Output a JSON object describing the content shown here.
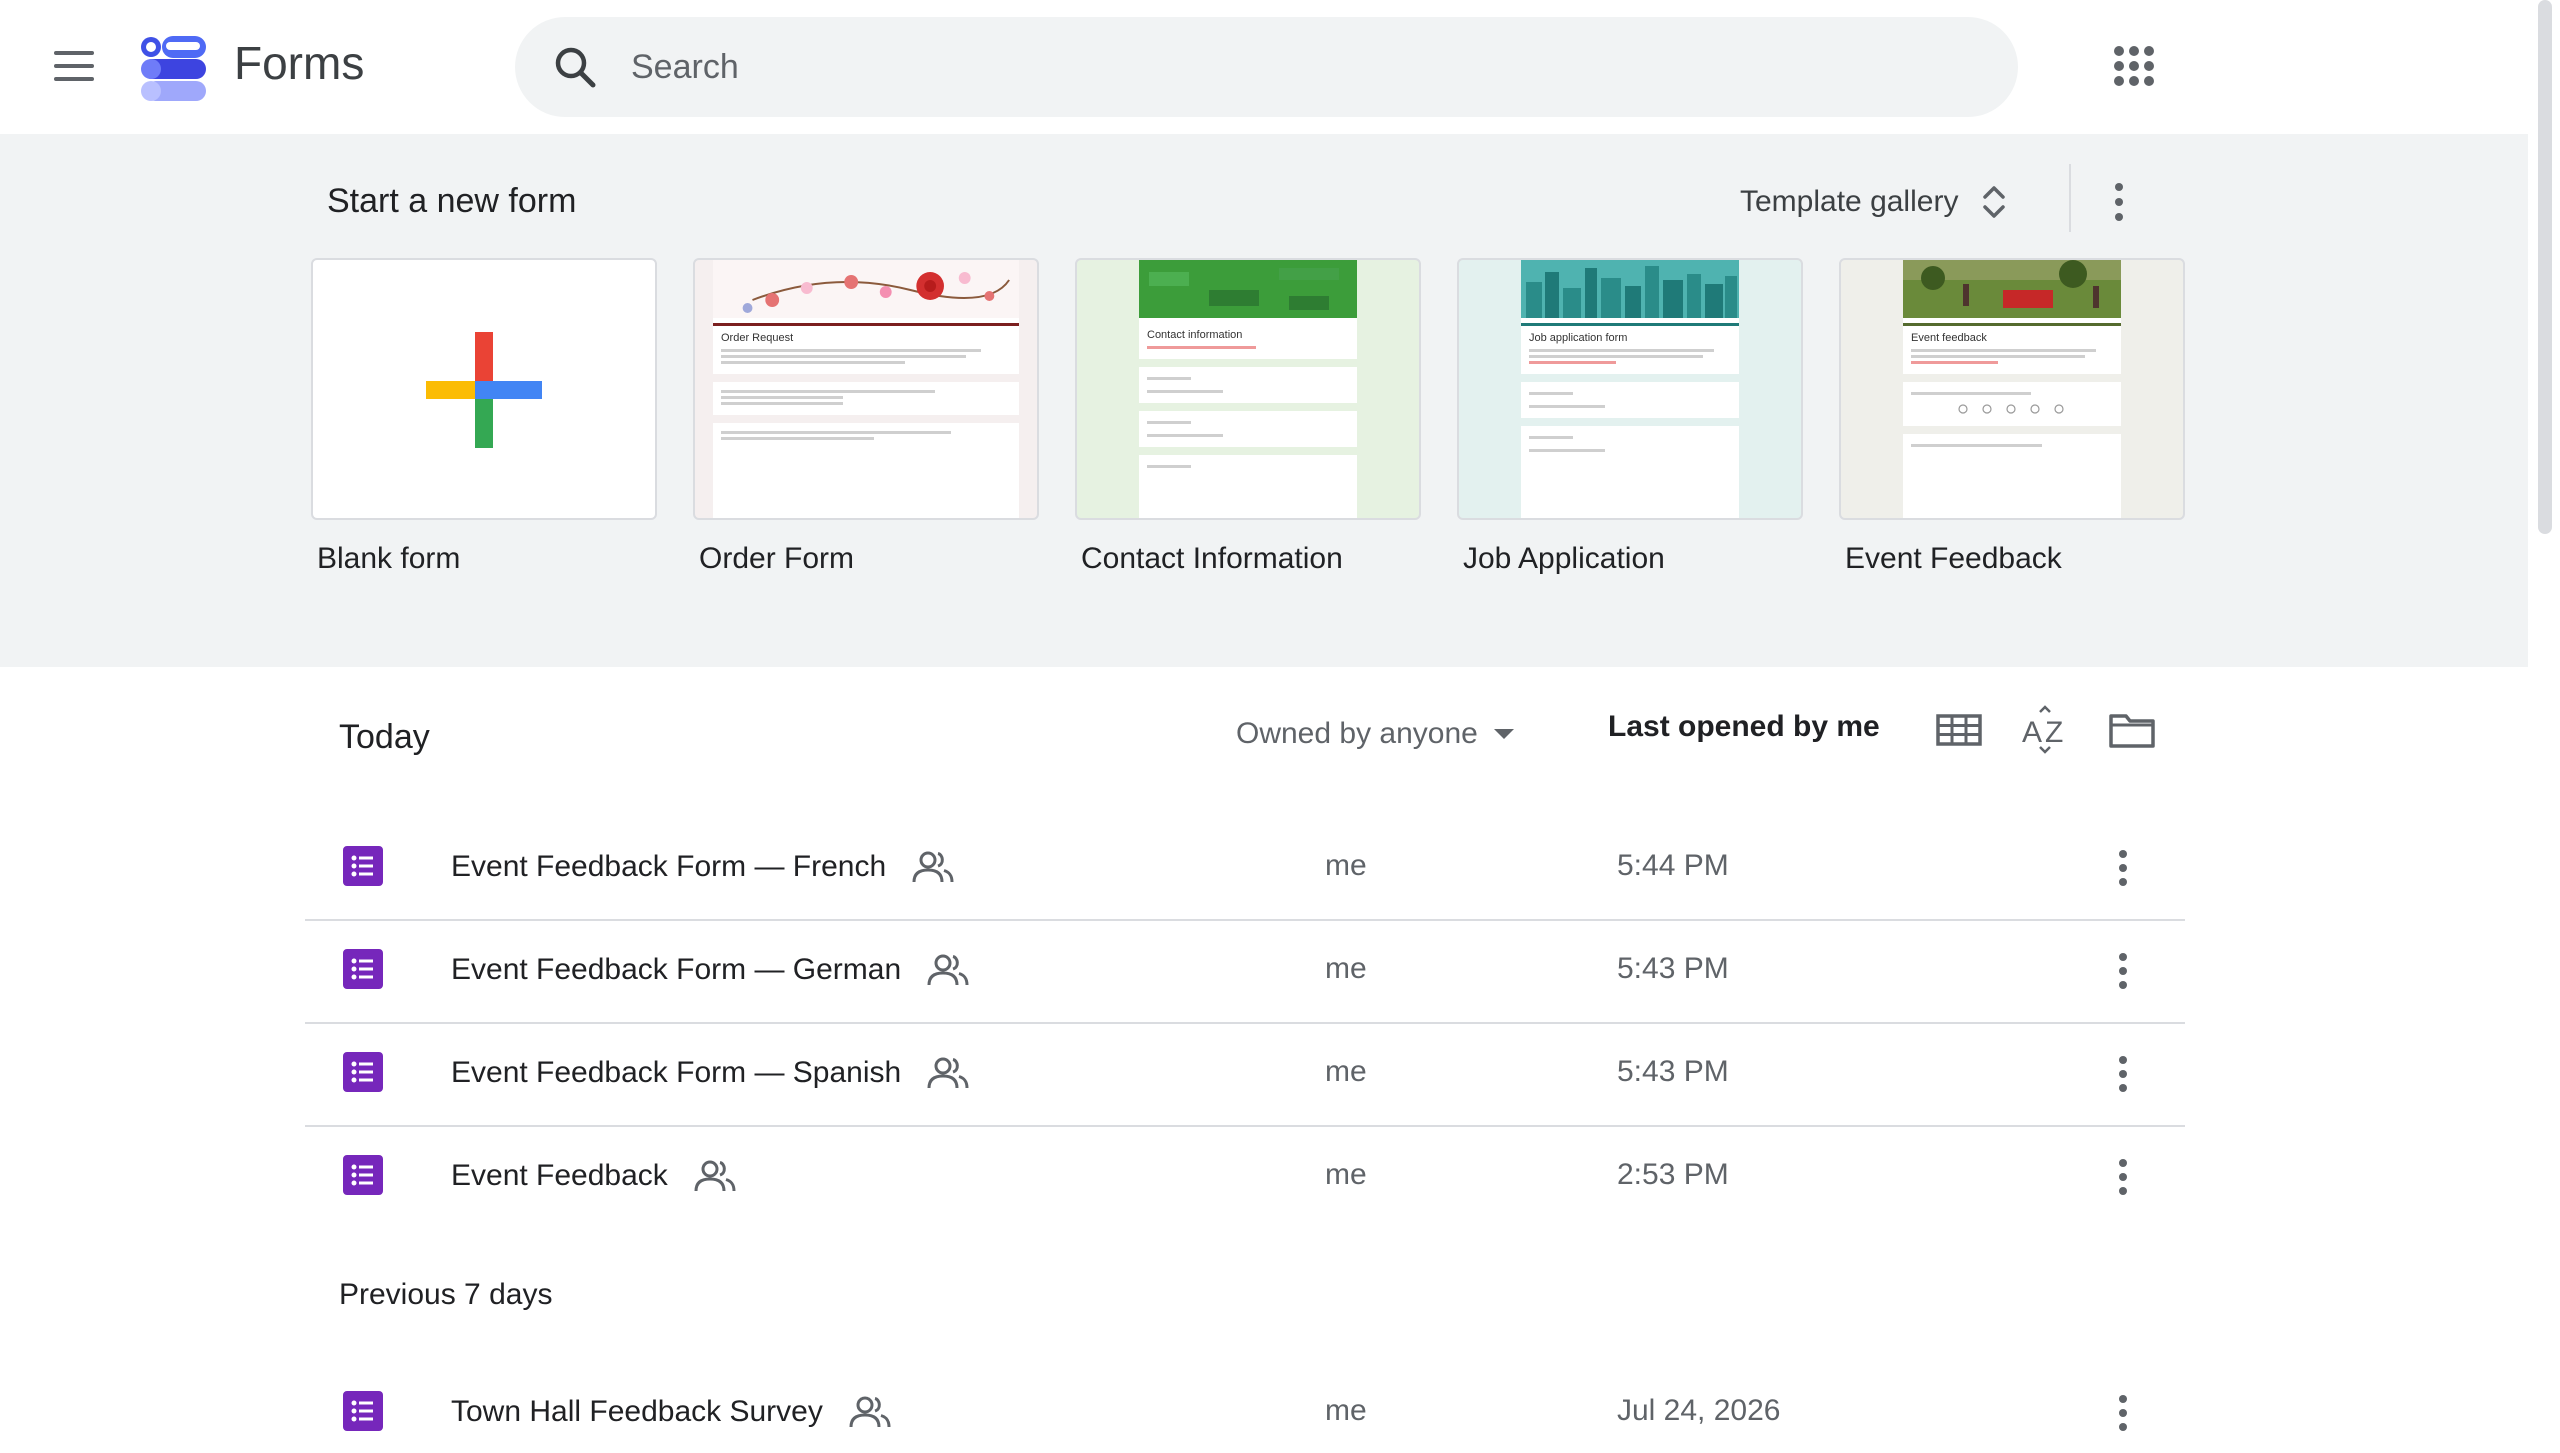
{
  "header": {
    "app_name": "Forms",
    "search_placeholder": "Search",
    "menu_icon": "hamburger-menu-icon",
    "apps_icon": "google-apps-grid-icon"
  },
  "templates": {
    "section_title": "Start a new form",
    "gallery_label": "Template gallery",
    "items": [
      {
        "label": "Blank form",
        "kind": "blank"
      },
      {
        "label": "Order Form",
        "kind": "order",
        "thumb_title": "Order Request"
      },
      {
        "label": "Contact Information",
        "kind": "contact",
        "thumb_title": "Contact information"
      },
      {
        "label": "Job Application",
        "kind": "job",
        "thumb_title": "Job application form"
      },
      {
        "label": "Event Feedback",
        "kind": "event",
        "thumb_title": "Event feedback"
      }
    ]
  },
  "list": {
    "today_label": "Today",
    "owner_filter": "Owned by anyone",
    "sort_label": "Last opened by me",
    "previous_label": "Previous 7 days",
    "rows": [
      {
        "title": "Event Feedback Form — French",
        "owner": "me",
        "date": "5:44 PM"
      },
      {
        "title": "Event Feedback Form — German",
        "owner": "me",
        "date": "5:43 PM"
      },
      {
        "title": "Event Feedback Form — Spanish",
        "owner": "me",
        "date": "5:43 PM"
      },
      {
        "title": "Event Feedback",
        "owner": "me",
        "date": "2:53 PM"
      },
      {
        "title": "Town Hall Feedback Survey",
        "owner": "me",
        "date": "Jul 24, 2026"
      }
    ]
  },
  "colors": {
    "forms_purple": "#7627bb",
    "template_bg": "#f1f3f4",
    "divider": "#dadce0"
  }
}
